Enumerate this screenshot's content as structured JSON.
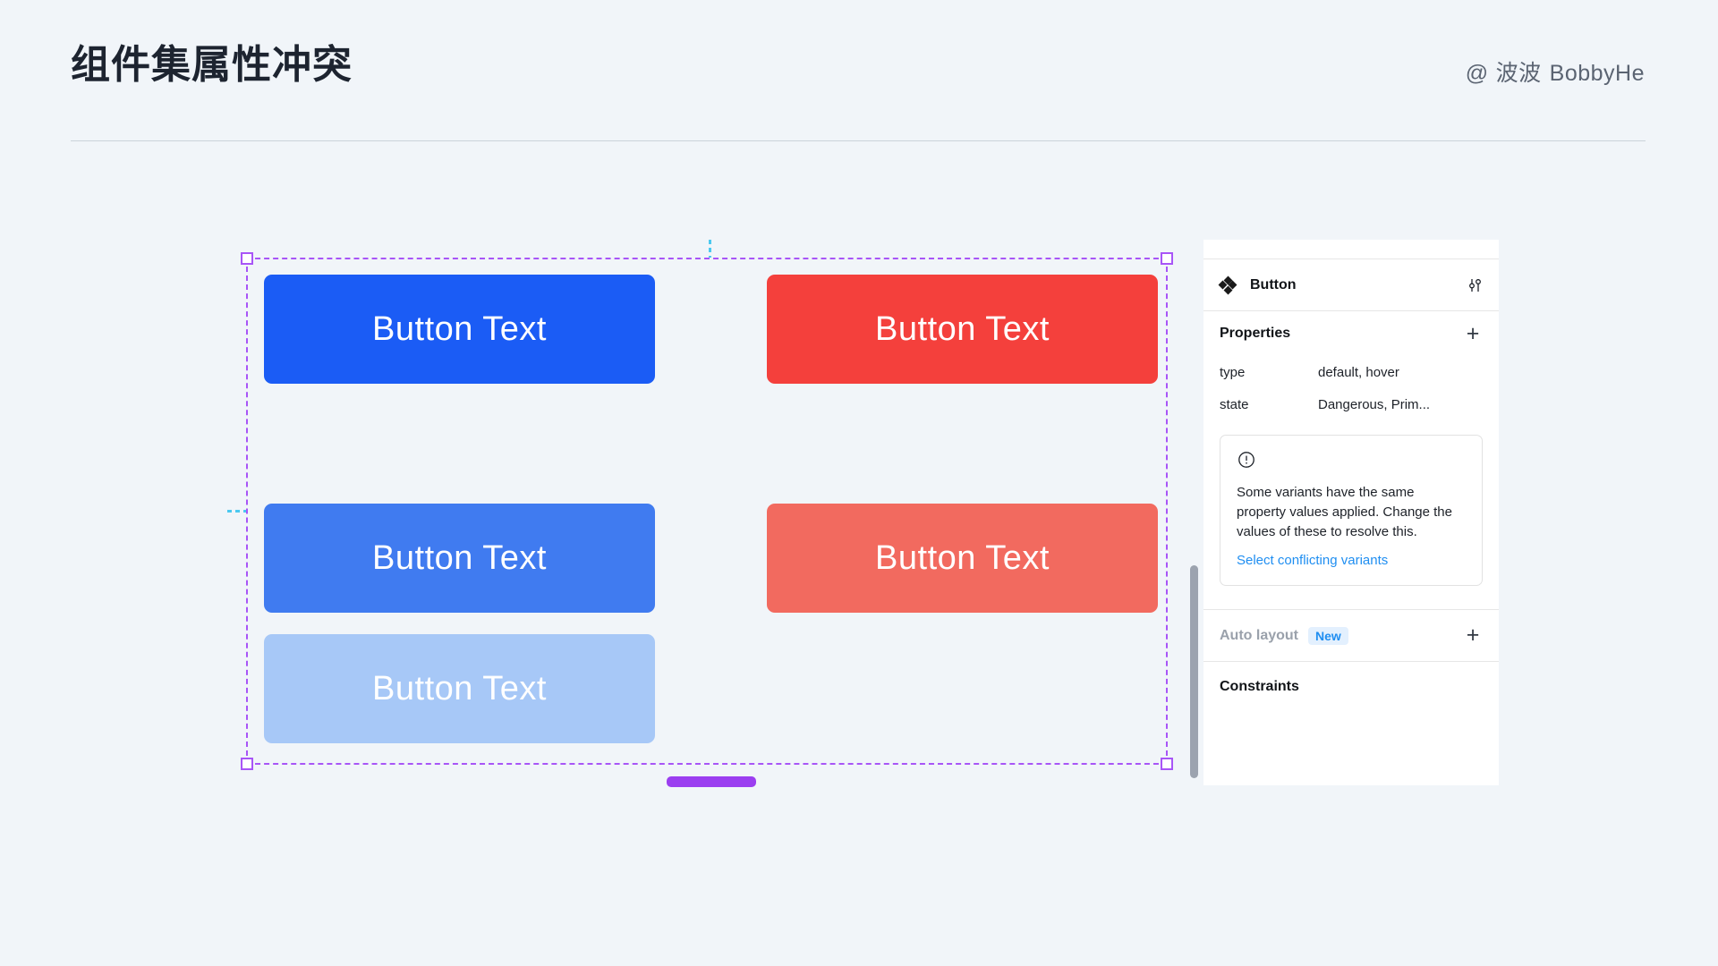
{
  "header": {
    "title": "组件集属性冲突",
    "attribution": {
      "at_symbol": "@",
      "handle_cn": "波波",
      "handle_en": "BobbyHe"
    }
  },
  "canvas": {
    "buttons": [
      {
        "label": "Button Text",
        "color": "#1b5cf5",
        "variant": "type=default, state=Primary"
      },
      {
        "label": "Button Text",
        "color": "#f4403c",
        "variant": "type=default, state=Dangerous"
      },
      {
        "label": "Button Text",
        "color": "#407bf0",
        "variant": "type=hover, state=Primary"
      },
      {
        "label": "Button Text",
        "color": "#f26a5f",
        "variant": "type=hover, state=Dangerous"
      },
      {
        "label": "Button Text",
        "color": "#a7c8f7",
        "variant": "type=hover, state=Primary"
      }
    ],
    "selection_color": "#a855f7",
    "guide_color": "#4cc9f0"
  },
  "panel": {
    "node_name": "Button",
    "properties": {
      "section_title": "Properties",
      "add_label": "+",
      "rows": [
        {
          "key": "type",
          "value": "default, hover"
        },
        {
          "key": "state",
          "value": "Dangerous, Prim..."
        }
      ]
    },
    "conflict_notice": {
      "message": "Some variants have the same property values applied. Change the values of these to resolve this.",
      "link_label": "Select conflicting variants",
      "link_color": "#1f8ef1"
    },
    "auto_layout": {
      "label": "Auto layout",
      "badge": "New",
      "add_label": "+"
    },
    "constraints": {
      "label": "Constraints"
    }
  }
}
